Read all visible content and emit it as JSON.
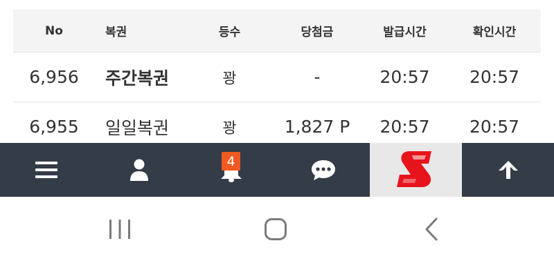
{
  "table": {
    "headers": {
      "no": "No",
      "lottery": "복권",
      "rank": "등수",
      "prize": "당첨금",
      "issued_time": "발급시간",
      "checked_time": "확인시간"
    },
    "rows": [
      {
        "no": "6,956",
        "lottery": "주간복권",
        "lottery_bold": true,
        "rank": "꽝",
        "prize": "-",
        "issued_time": "20:57",
        "checked_time": "20:57"
      },
      {
        "no": "6,955",
        "lottery": "일일복권",
        "lottery_bold": false,
        "rank": "꽝",
        "prize": "1,827 P",
        "issued_time": "20:57",
        "checked_time": "20:57"
      }
    ]
  },
  "bottom_bar": {
    "notification_count": "4",
    "icons": [
      "hamburger-menu-icon",
      "user-icon",
      "bell-icon",
      "chat-bubble-icon",
      "site-logo",
      "arrow-up-icon"
    ],
    "colors": {
      "background": "#343c48",
      "badge": "#f05a22",
      "logo_bg": "#e8e8e8",
      "logo_red": "#e8141c"
    }
  },
  "system_nav": {
    "icons": [
      "recent-apps-icon",
      "home-icon",
      "back-icon"
    ]
  }
}
